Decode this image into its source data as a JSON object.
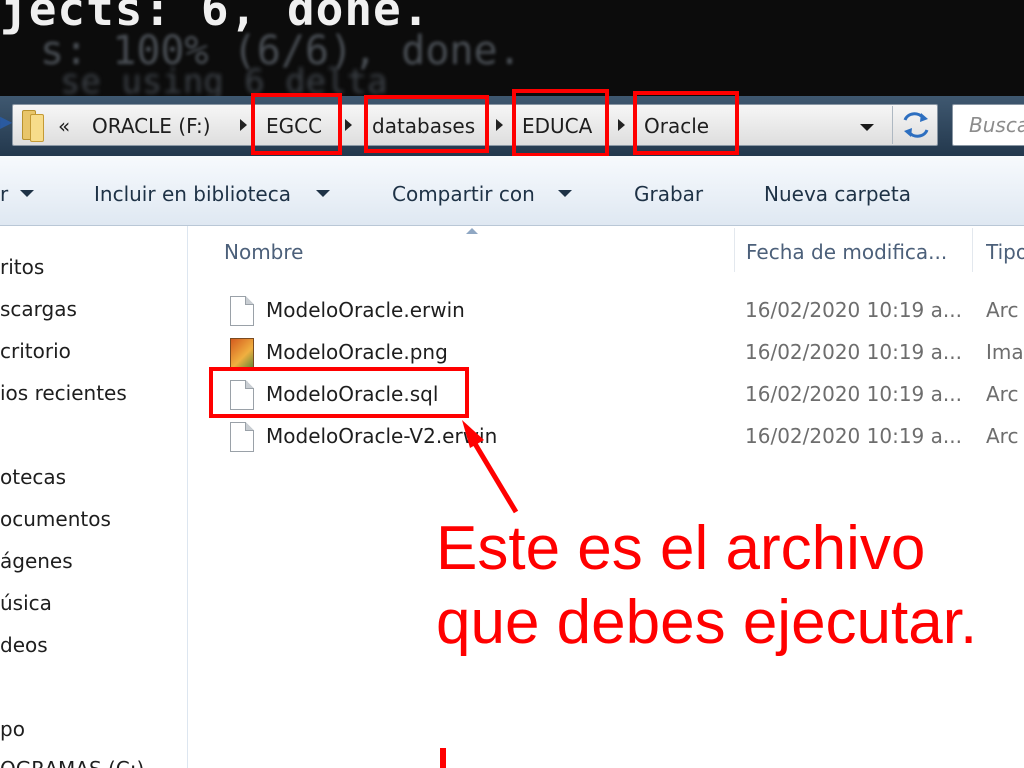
{
  "terminal": {
    "line1": "jects: 6, done.",
    "line2": "s: 100% (6/6), done.",
    "line3": "se using 6 delta"
  },
  "address_bar": {
    "overflow_chevron": "«",
    "crumbs": [
      "ORACLE (F:)",
      "EGCC",
      "databases",
      "EDUCA",
      "Oracle"
    ],
    "search_placeholder": "Busca"
  },
  "toolbar": {
    "organize_partial": "r",
    "include_library": "Incluir en biblioteca",
    "share_with": "Compartir con",
    "burn": "Grabar",
    "new_folder": "Nueva carpeta"
  },
  "nav_pane": {
    "items": [
      "ritos",
      "scargas",
      "critorio",
      "ios recientes",
      "otecas",
      "ocumentos",
      "ágenes",
      "úsica",
      "deos",
      "po",
      "OGRAMAS (C:)"
    ]
  },
  "columns": {
    "name": "Nombre",
    "date": "Fecha de modifica...",
    "type": "Tipo"
  },
  "files": [
    {
      "name": "ModeloOracle.erwin",
      "date": "16/02/2020 10:19 a...",
      "type": "Arc",
      "icon": "file-icon"
    },
    {
      "name": "ModeloOracle.png",
      "date": "16/02/2020 10:19 a...",
      "type": "Ima",
      "icon": "image-file-icon"
    },
    {
      "name": "ModeloOracle.sql",
      "date": "16/02/2020 10:19 a...",
      "type": "Arc",
      "icon": "file-icon"
    },
    {
      "name": "ModeloOracle-V2.erwin",
      "date": "16/02/2020 10:19 a...",
      "type": "Arc",
      "icon": "file-icon"
    }
  ],
  "annotation": {
    "line1": "Este es el archivo",
    "line2": "que debes ejecutar."
  },
  "colors": {
    "annotation_red": "#ff0000",
    "address_bar_bg": "#23384d",
    "toolbar_text": "#1e3246"
  }
}
